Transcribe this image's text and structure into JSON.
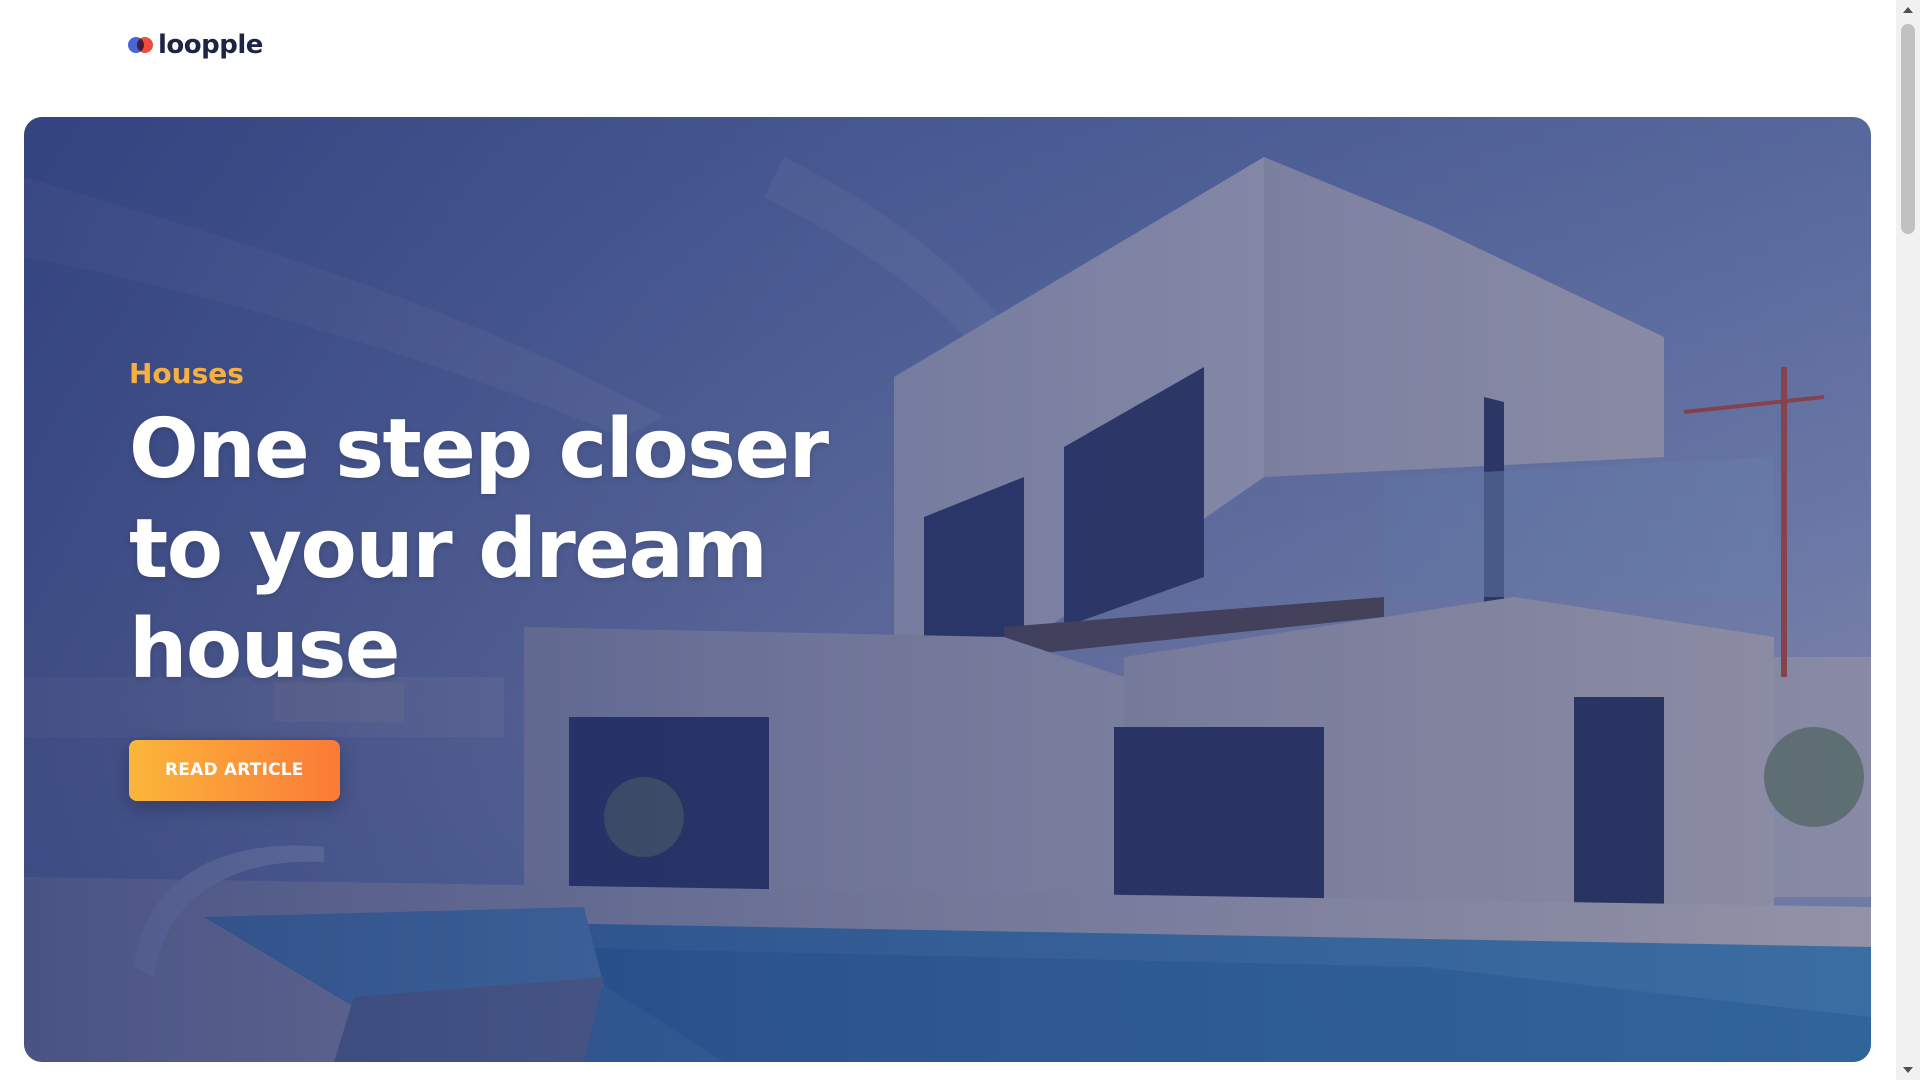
{
  "brand": {
    "name": "loopple",
    "colors": {
      "blue": "#4a63d6",
      "red": "#ef4b3e",
      "text": "#1f2344"
    }
  },
  "hero": {
    "category": "Houses",
    "headline_lines": [
      "One step closer",
      "to your dream",
      "house"
    ],
    "cta_label": "READ ARTICLE",
    "colors": {
      "category": "#f5b041",
      "cta_start": "#fbb63a",
      "cta_end": "#fb7a37"
    },
    "image_icon": "modern-house-pool-photo"
  },
  "scrollbar": {
    "up_icon": "scroll-up-arrow-icon",
    "down_icon": "scroll-down-arrow-icon"
  }
}
